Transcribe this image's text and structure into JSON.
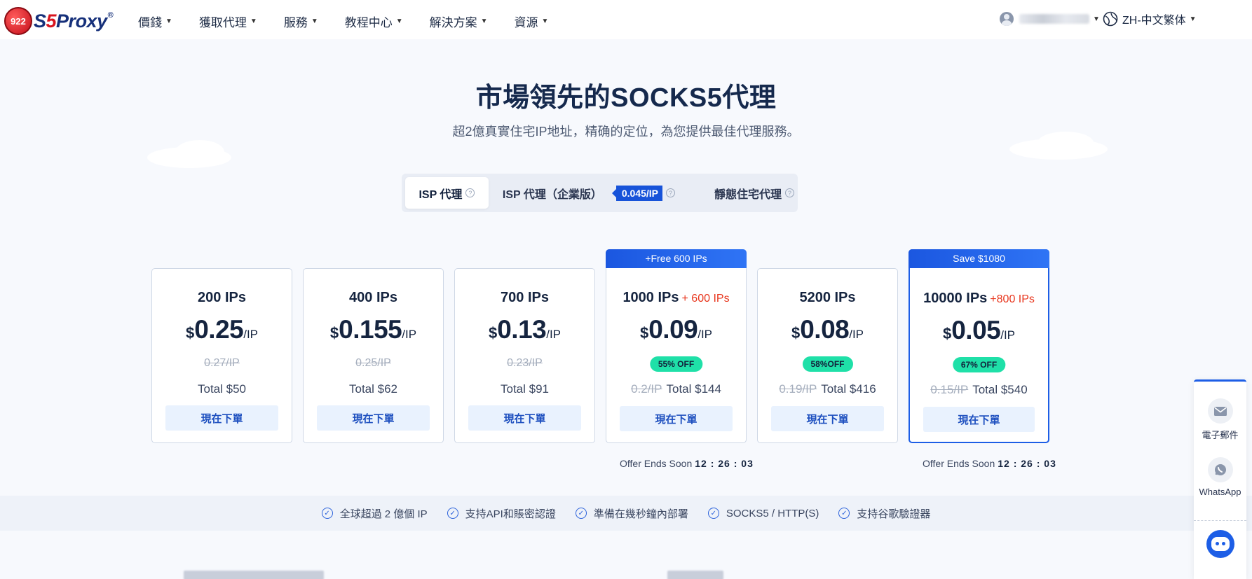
{
  "brand": {
    "badge": "922",
    "name_a": "S",
    "name_b": "5",
    "name_c": "Proxy",
    "reg": "®"
  },
  "nav": {
    "items": [
      {
        "label": "價錢"
      },
      {
        "label": "獲取代理"
      },
      {
        "label": "服務"
      },
      {
        "label": "教程中心"
      },
      {
        "label": "解決方案"
      },
      {
        "label": "資源"
      }
    ],
    "language": "ZH-中文繁体"
  },
  "hero": {
    "title": "市場領先的SOCKS5代理",
    "subtitle": "超2億真實住宅IP地址，精确的定位，為您提供最佳代理服務。"
  },
  "tabs": {
    "isp": "ISP 代理",
    "isp_enterprise": "ISP 代理（企業版）",
    "isp_enterprise_price": "0.045/IP",
    "static_residential": "靜態住宅代理",
    "help": "?"
  },
  "cards": [
    {
      "title": "200 IPs",
      "currency": "$",
      "price": "0.25",
      "unit": "/IP",
      "old": "0.27/IP",
      "total": "Total $50",
      "button": "現在下單"
    },
    {
      "title": "400 IPs",
      "currency": "$",
      "price": "0.155",
      "unit": "/IP",
      "old": "0.25/IP",
      "total": "Total $62",
      "button": "現在下單"
    },
    {
      "title": "700 IPs",
      "currency": "$",
      "price": "0.13",
      "unit": "/IP",
      "old": "0.23/IP",
      "total": "Total $91",
      "button": "現在下單"
    },
    {
      "banner": "+Free 600 IPs",
      "title": "1000 IPs",
      "bonus": "+ 600 IPs",
      "currency": "$",
      "price": "0.09",
      "unit": "/IP",
      "off": "55% OFF",
      "old": "0.2/IP",
      "total": "Total $144",
      "button": "現在下單"
    },
    {
      "title": "5200 IPs",
      "currency": "$",
      "price": "0.08",
      "unit": "/IP",
      "off": "58%OFF",
      "old": "0.19/IP",
      "total": "Total $416",
      "button": "現在下單"
    },
    {
      "banner": "Save $1080",
      "title": "10000 IPs",
      "bonus": "+800 IPs",
      "currency": "$",
      "price": "0.05",
      "unit": "/IP",
      "off": "67% OFF",
      "old": "0.15/IP",
      "total": "Total $540",
      "button": "現在下單"
    }
  ],
  "offers": [
    {
      "label": "Offer Ends Soon",
      "time": "12 : 26 : 03"
    },
    {
      "label": "Offer Ends Soon",
      "time": "12 : 26 : 03"
    }
  ],
  "features": [
    "全球超過 2 億個 IP",
    "支持API和賬密認證",
    "準備在幾秒鐘內部署",
    "SOCKS5 / HTTP(S)",
    "支持谷歌驗證器"
  ],
  "contact": {
    "email": "電子郵件",
    "whatsapp": "WhatsApp"
  },
  "colors": {
    "accent": "#1d5ee6",
    "discount": "#1fe0a8",
    "bonus": "#e8361d",
    "brand_red": "#d8141e",
    "brand_navy": "#16307a"
  }
}
